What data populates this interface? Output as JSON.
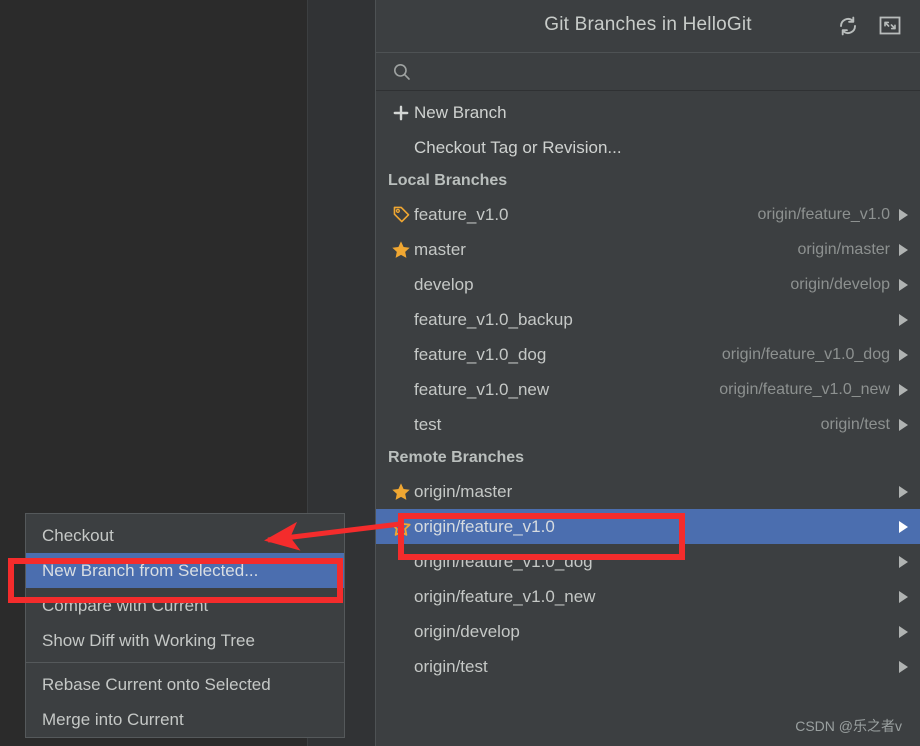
{
  "window": {
    "title": "Git Branches in HelloGit",
    "header_icons": [
      {
        "name": "refresh-icon",
        "label": "Refresh"
      },
      {
        "name": "restore-window-icon",
        "label": "Restore Window"
      }
    ]
  },
  "search": {
    "value": "",
    "placeholder": "",
    "icon": "search-icon"
  },
  "actions": [
    {
      "label": "New Branch",
      "icon": "plus-icon"
    },
    {
      "label": "Checkout Tag or Revision...",
      "icon": ""
    }
  ],
  "local_section": {
    "title": "Local Branches",
    "branches": [
      {
        "name": "feature_v1.0",
        "icon": "tag-icon",
        "tracking": "origin/feature_v1.0",
        "arrow": true
      },
      {
        "name": "master",
        "icon": "star-filled-icon",
        "tracking": "origin/master",
        "arrow": true
      },
      {
        "name": "develop",
        "icon": "",
        "tracking": "origin/develop",
        "arrow": true
      },
      {
        "name": "feature_v1.0_backup",
        "icon": "",
        "tracking": "",
        "arrow": true
      },
      {
        "name": "feature_v1.0_dog",
        "icon": "",
        "tracking": "origin/feature_v1.0_dog",
        "arrow": true
      },
      {
        "name": "feature_v1.0_new",
        "icon": "",
        "tracking": "origin/feature_v1.0_new",
        "arrow": true
      },
      {
        "name": "test",
        "icon": "",
        "tracking": "origin/test",
        "arrow": true
      }
    ]
  },
  "remote_section": {
    "title": "Remote Branches",
    "branches": [
      {
        "name": "origin/master",
        "icon": "star-filled-icon",
        "selected": false,
        "arrow": true
      },
      {
        "name": "origin/feature_v1.0",
        "icon": "star-outline-icon",
        "selected": true,
        "arrow": true
      },
      {
        "name": "origin/feature_v1.0_dog",
        "icon": "",
        "selected": false,
        "arrow": true
      },
      {
        "name": "origin/feature_v1.0_new",
        "icon": "",
        "selected": false,
        "arrow": true
      },
      {
        "name": "origin/develop",
        "icon": "",
        "selected": false,
        "arrow": true
      },
      {
        "name": "origin/test",
        "icon": "",
        "selected": false,
        "arrow": true
      }
    ]
  },
  "context_menu": {
    "items": [
      {
        "label": "Checkout",
        "highlighted": false,
        "separator_after": false
      },
      {
        "label": "New Branch from Selected...",
        "highlighted": true,
        "separator_after": false
      },
      {
        "label": "Compare with Current",
        "highlighted": false,
        "separator_after": false
      },
      {
        "label": "Show Diff with Working Tree",
        "highlighted": false,
        "separator_after": true
      },
      {
        "label": "Rebase Current onto Selected",
        "highlighted": false,
        "separator_after": false
      },
      {
        "label": "Merge into Current",
        "highlighted": false,
        "separator_after": false
      }
    ]
  },
  "watermark": {
    "text": "CSDN @乐之者v"
  },
  "annotations": {
    "highlight_color": "#f42c2c",
    "boxes": [
      {
        "name": "new-branch-from-selected",
        "target": "New Branch from Selected..."
      },
      {
        "name": "origin-feature-v1-0",
        "target": "origin/feature_v1.0"
      }
    ],
    "arrow": {
      "from": "origin/feature_v1.0",
      "to": "New Branch from Selected..."
    }
  },
  "theme": {
    "popup_bg": "#3c3f41",
    "backdrop_bg": "#2b2b2b",
    "selection_blue": "#4b6eaf",
    "accent_orange": "#f0a732",
    "text": "#c5c8c6",
    "muted_text": "#8d9190"
  }
}
